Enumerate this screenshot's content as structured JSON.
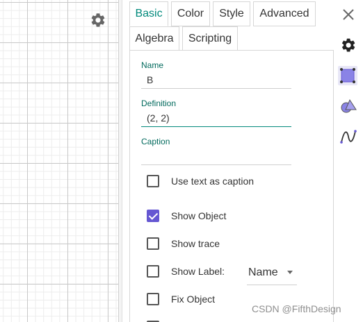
{
  "tabs": [
    {
      "label": "Basic",
      "active": true
    },
    {
      "label": "Color",
      "active": false
    },
    {
      "label": "Style",
      "active": false
    },
    {
      "label": "Advanced",
      "active": false
    },
    {
      "label": "Algebra",
      "active": false
    },
    {
      "label": "Scripting",
      "active": false
    }
  ],
  "fields": {
    "name_label": "Name",
    "name_value": "B",
    "definition_label": "Definition",
    "definition_value": "(2, 2)",
    "caption_label": "Caption",
    "caption_value": ""
  },
  "checkboxes": [
    {
      "label": "Use text as caption",
      "checked": false
    },
    {
      "label": "Show Object",
      "checked": true
    },
    {
      "label": "Show trace",
      "checked": false
    },
    {
      "label": "Show Label:",
      "checked": false
    },
    {
      "label": "Fix Object",
      "checked": false
    }
  ],
  "label_select": {
    "selected": "Name"
  },
  "sidebar": {
    "icons": [
      "gear-icon",
      "point-style-icon",
      "geometry-shapes-icon",
      "curve-icon"
    ]
  },
  "colors": {
    "accent": "#00897b",
    "checkbox_checked": "#6557d2",
    "point_icon": "#8a83e6"
  },
  "watermark": "CSDN @FifthDesign"
}
